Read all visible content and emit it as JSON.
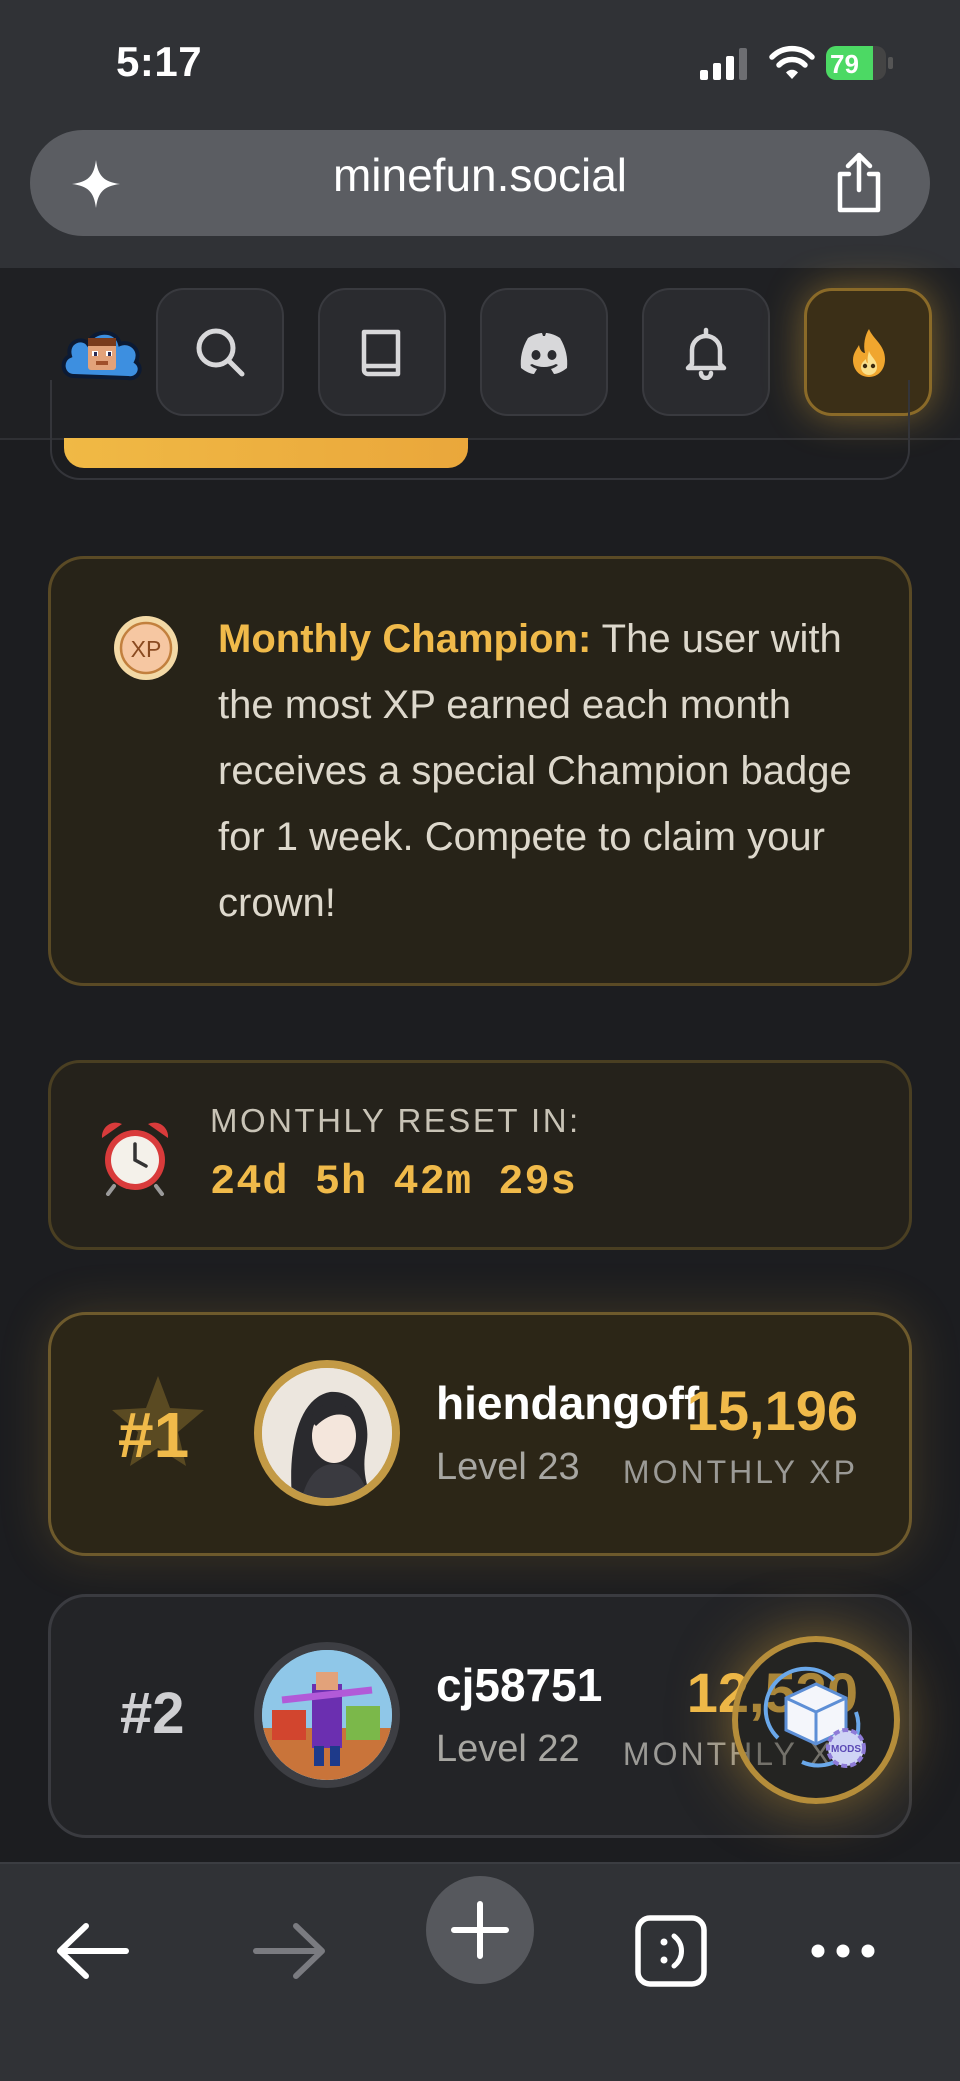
{
  "status": {
    "time": "5:17",
    "battery": "79",
    "battery_level": 79
  },
  "browser": {
    "url": "minefun.social"
  },
  "colors": {
    "accent": "#f0ba4a",
    "background": "#1c1d20",
    "card_gold_border": "#6e5a2c"
  },
  "nav": {
    "icons": [
      "search-icon",
      "book-icon",
      "discord-icon",
      "bell-icon",
      "fire-icon"
    ]
  },
  "champion": {
    "icon_label": "XP",
    "title": "Monthly Champion:",
    "text": " The user with the most XP earned each month receives a special Champion badge for 1 week. Compete to claim your crown!"
  },
  "reset": {
    "label": "MONTHLY RESET IN:",
    "countdown": "24d 5h 42m 29s"
  },
  "leaderboard": [
    {
      "rank": "#1",
      "username": "hiendangoff",
      "level": "Level 23",
      "xp": "15,196",
      "xp_label": "MONTHLY XP"
    },
    {
      "rank": "#2",
      "username": "cj58751",
      "level": "Level 22",
      "xp": "12,530",
      "xp_label": "MONTHLY XP"
    }
  ],
  "fab": {
    "badge": "MODS"
  }
}
